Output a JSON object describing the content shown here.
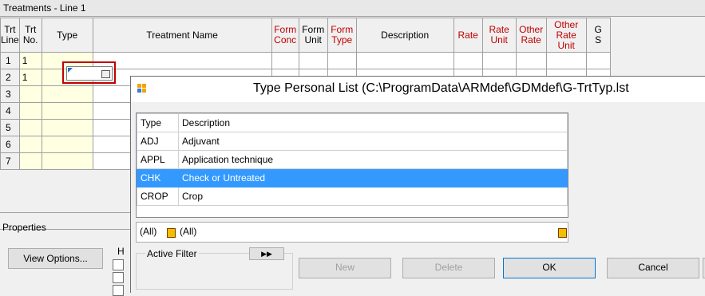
{
  "window": {
    "title": "Treatments - Line 1"
  },
  "grid": {
    "headers": [
      {
        "label": "Trt\nLine",
        "red": false
      },
      {
        "label": "Trt\nNo.",
        "red": false
      },
      {
        "label": "Type",
        "red": false
      },
      {
        "label": "Treatment Name",
        "red": false
      },
      {
        "label": "Form\nConc",
        "red": true
      },
      {
        "label": "Form\nUnit",
        "red": false
      },
      {
        "label": "Form\nType",
        "red": true
      },
      {
        "label": "Description",
        "red": false
      },
      {
        "label": "Rate",
        "red": true
      },
      {
        "label": "Rate\nUnit",
        "red": true
      },
      {
        "label": "Other\nRate",
        "red": true
      },
      {
        "label": "Other\nRate Unit",
        "red": true
      },
      {
        "label": "G\nS",
        "red": false
      }
    ],
    "rows": [
      {
        "line": "1",
        "trt": "1"
      },
      {
        "line": "2",
        "trt": "1"
      },
      {
        "line": "3",
        "trt": ""
      },
      {
        "line": "4",
        "trt": ""
      },
      {
        "line": "5",
        "trt": ""
      },
      {
        "line": "6",
        "trt": ""
      },
      {
        "line": "7",
        "trt": ""
      }
    ]
  },
  "properties": {
    "label": "Properties",
    "view_options_button": "View Options...",
    "partial_label": "H"
  },
  "dialog": {
    "title": "Type Personal List (C:\\ProgramData\\ARMdef\\GDMdef\\G-TrtTyp.lst",
    "columns": [
      "Type",
      "Description"
    ],
    "items": [
      {
        "type": "ADJ",
        "description": "Adjuvant",
        "selected": false
      },
      {
        "type": "APPL",
        "description": "Application technique",
        "selected": false
      },
      {
        "type": "CHK",
        "description": "Check or Untreated",
        "selected": true
      },
      {
        "type": "CROP",
        "description": "Crop",
        "selected": false
      }
    ],
    "filter": {
      "type_value": "(All)",
      "description_value": "(All)"
    },
    "active_filter_label": "Active Filter",
    "buttons": {
      "new": "New",
      "delete": "Delete",
      "ok": "OK",
      "cancel": "Cancel"
    }
  },
  "colors": {
    "accent_selection": "#3399ff",
    "required_header": "#c00000",
    "focus_outline": "#c00000"
  }
}
